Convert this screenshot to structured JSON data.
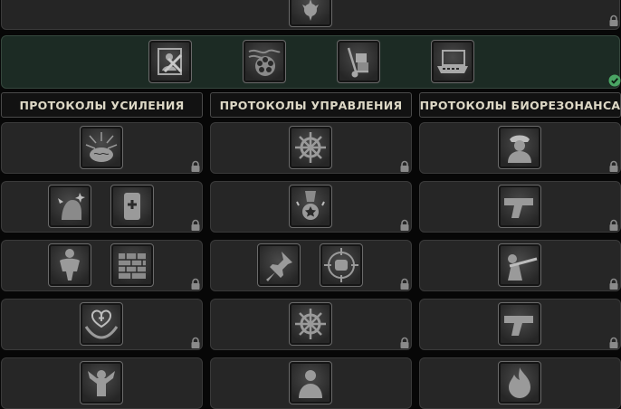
{
  "categories": [
    {
      "label": "ПРОТОКОЛЫ УСИЛЕНИЯ"
    },
    {
      "label": "ПРОТОКОЛЫ УПРАВЛЕНИЯ"
    },
    {
      "label": "ПРОТОКОЛЫ БИОРЕЗОНАНСА"
    }
  ],
  "status": {
    "top_row": "locked",
    "active_row": "completed",
    "tree_rows": "locked"
  },
  "icons": {
    "top_row": [
      "spiked-burst-icon"
    ],
    "active_row": [
      "photo-cross-icon",
      "revolver-cylinder-icon",
      "hand-truck-icon",
      "laptop-case-icon"
    ],
    "enhancement": [
      "brain-burst-icon",
      "bruised-face-icon",
      "bandage-icon",
      "muscle-body-icon",
      "brick-wall-icon",
      "heart-hands-icon",
      "strength-pose-icon"
    ],
    "control": [
      "ships-wheel-icon",
      "star-medal-icon",
      "push-pin-icon",
      "fist-target-icon",
      "ships-wheel-icon",
      "leader-portrait-icon"
    ],
    "bioresonance": [
      "officer-portrait-icon",
      "pistol-icon",
      "sniper-icon",
      "pistol-icon",
      "fire-icon"
    ]
  },
  "colors": {
    "background": "#070707",
    "panel": "#262626",
    "active_panel": "#1c2b24",
    "header_text": "#ddd8c6",
    "check": "#4aa564"
  }
}
